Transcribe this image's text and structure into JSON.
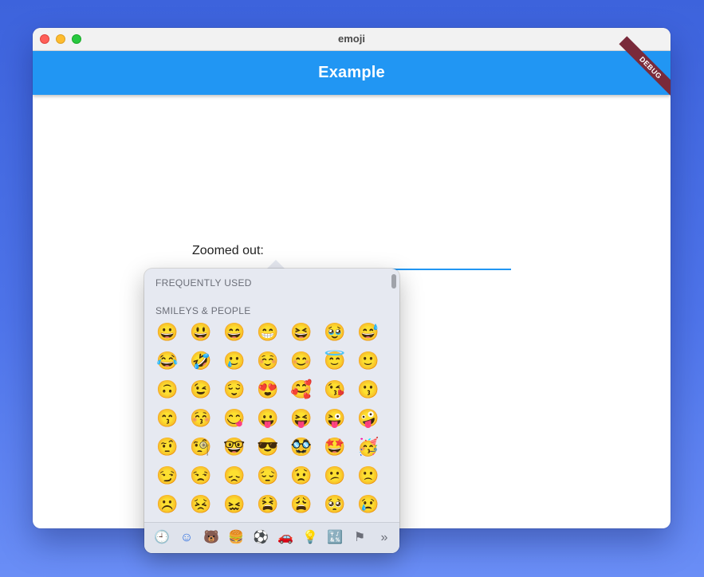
{
  "window": {
    "title": "emoji"
  },
  "appbar": {
    "title": "Example",
    "debug_label": "DEBUG"
  },
  "content": {
    "label": "Zoomed out:"
  },
  "picker": {
    "frequently_used_label": "FREQUENTLY USED",
    "smileys_label": "SMILEYS & PEOPLE",
    "emojis": [
      "😀",
      "😃",
      "😄",
      "😁",
      "😆",
      "🥹",
      "😅",
      "😂",
      "🤣",
      "🥲",
      "☺️",
      "😊",
      "😇",
      "🙂",
      "🙃",
      "😉",
      "😌",
      "😍",
      "🥰",
      "😘",
      "😗",
      "😙",
      "😚",
      "😋",
      "😛",
      "😝",
      "😜",
      "🤪",
      "🤨",
      "🧐",
      "🤓",
      "😎",
      "🥸",
      "🤩",
      "🥳",
      "😏",
      "😒",
      "😞",
      "😔",
      "😟",
      "😕",
      "🙁",
      "☹️",
      "😣",
      "😖",
      "😫",
      "😩",
      "🥺",
      "😢"
    ],
    "categories": [
      {
        "name": "recent-icon",
        "glyph": "🕘"
      },
      {
        "name": "smileys-icon",
        "glyph": "☺"
      },
      {
        "name": "animals-icon",
        "glyph": "🐻"
      },
      {
        "name": "food-icon",
        "glyph": "🍔"
      },
      {
        "name": "activity-icon",
        "glyph": "⚽"
      },
      {
        "name": "travel-icon",
        "glyph": "🚗"
      },
      {
        "name": "objects-icon",
        "glyph": "💡"
      },
      {
        "name": "symbols-icon",
        "glyph": "🔣"
      },
      {
        "name": "flags-icon",
        "glyph": "⚑"
      },
      {
        "name": "more-icon",
        "glyph": "»"
      }
    ],
    "active_category": 1
  }
}
